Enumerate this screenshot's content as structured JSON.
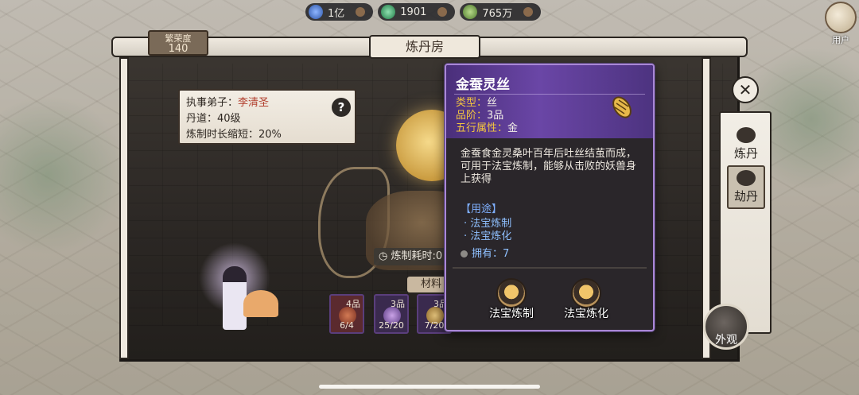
{
  "resources": [
    {
      "icon": "blue-crystal-icon",
      "value": "1亿",
      "color": "#4d7fd1"
    },
    {
      "icon": "green-jade-icon",
      "value": "1901",
      "color": "#3fa06a"
    },
    {
      "icon": "herb-icon",
      "value": "765万",
      "color": "#6a9a4a"
    }
  ],
  "user": {
    "label": "用户"
  },
  "prosperity": {
    "label": "繁荣度",
    "value": "140"
  },
  "house": {
    "title": "炼丹房"
  },
  "info": {
    "disciple_label": "执事弟子：",
    "disciple_name": "李清圣",
    "dandao": "丹道：40级",
    "reduce": "炼制时长缩短：20%",
    "help": "?"
  },
  "cost": {
    "text": "炼制耗时:0"
  },
  "materials": {
    "label": "材料",
    "slots": [
      {
        "grade": "4品",
        "count": "6/4"
      },
      {
        "grade": "3品",
        "count": "25/20"
      },
      {
        "grade": "3品",
        "count": "7/20"
      }
    ]
  },
  "side_tabs": [
    {
      "label": "炼丹",
      "icon": "cauldron-icon"
    },
    {
      "label": "劫丹",
      "icon": "eye-icon"
    }
  ],
  "close": "✕",
  "outlook": {
    "label": "外观"
  },
  "popup": {
    "title": "金蚕灵丝",
    "attrs": [
      {
        "key": "类型：",
        "value": "丝"
      },
      {
        "key": "品阶：",
        "value": "3品"
      },
      {
        "key": "五行属性：",
        "value": "金"
      }
    ],
    "description": "金蚕食金灵桑叶百年后吐丝结茧而成，可用于法宝炼制，能够从击败的妖兽身上获得",
    "usage_title": "【用途】",
    "usage_items": [
      "· 法宝炼制",
      "· 法宝炼化"
    ],
    "owned": "拥有：7",
    "actions": [
      {
        "label": "法宝炼制",
        "icon": "artifact-forge-icon"
      },
      {
        "label": "法宝炼化",
        "icon": "artifact-refine-icon"
      }
    ],
    "accent": "#a987d6"
  }
}
